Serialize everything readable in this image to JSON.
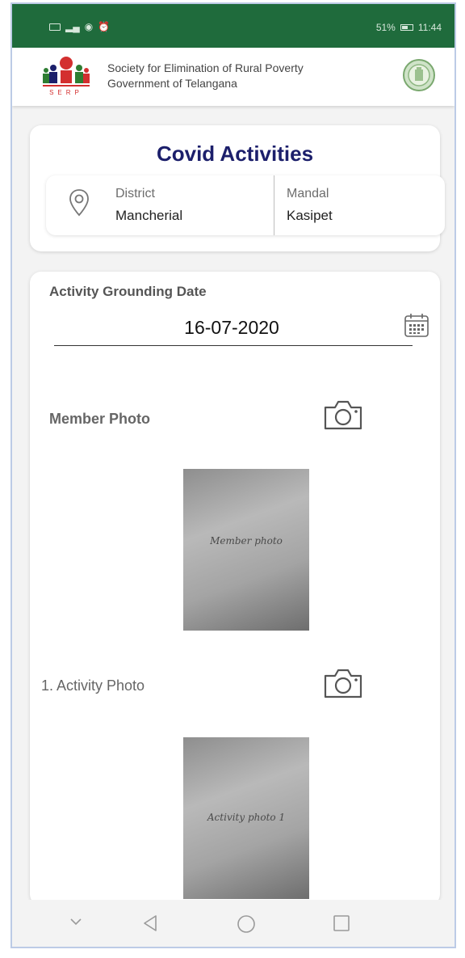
{
  "status_bar": {
    "battery": "51%",
    "time": "11:44",
    "icons": [
      "sim-icon",
      "signal-icon",
      "hotspot-icon",
      "alarm-icon",
      "battery-icon"
    ]
  },
  "header": {
    "org_line1": "Society for Elimination of Rural Poverty",
    "org_line2": "Government of Telangana",
    "logo_text": "SERP",
    "colors": {
      "status_bar": "#1f6b3c",
      "title": "#1c1f6b"
    }
  },
  "location_card": {
    "title": "Covid Activities",
    "district_label": "District",
    "district_value": "Mancherial",
    "mandal_label": "Mandal",
    "mandal_value": "Kasipet"
  },
  "form": {
    "date_label": "Activity Grounding Date",
    "date_value": "16-07-2020",
    "member_photo_label": "Member Photo",
    "member_photo_caption": "Member photo",
    "activity_photo_label": "1. Activity Photo",
    "activity_photo_caption": "Activity photo 1"
  },
  "nav_bar": {
    "buttons": [
      "chevron-down-icon",
      "back-icon",
      "home-icon",
      "recents-icon"
    ]
  }
}
